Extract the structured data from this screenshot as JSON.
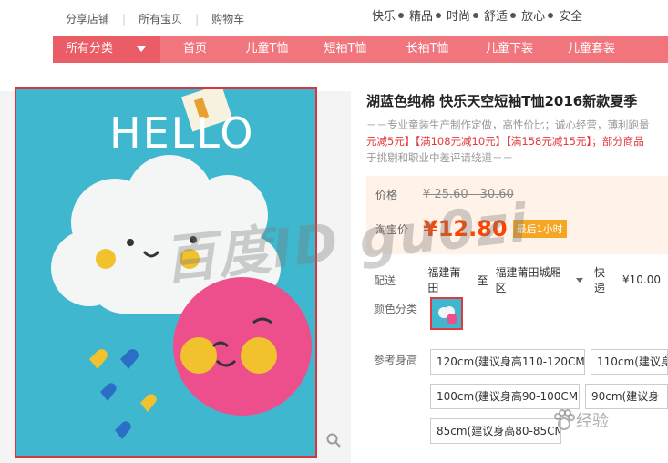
{
  "top_links": [
    "分享店铺",
    "所有宝贝",
    "购物车"
  ],
  "slogan": [
    "快乐",
    "精品",
    "时尚",
    "舒适",
    "放心",
    "安全"
  ],
  "nav": {
    "all_label": "所有分类",
    "items": [
      "首页",
      "儿童T恤",
      "短袖T恤",
      "长袖T恤",
      "儿童下装",
      "儿童套装"
    ]
  },
  "product": {
    "image_text": "HELLO",
    "title": "湖蓝色纯棉 快乐天空短袖T恤2016新款夏季",
    "subtitle_1": "－－专业童装生产制作定做，高性价比；诚心经营，薄利跑量",
    "subtitle_2": "元减5元】【满108元减10元】【满158元减15元】；部分商品",
    "subtitle_3": "于挑剔和职业中差评请绕道－－"
  },
  "price": {
    "label": "价格",
    "old": "¥ 25.60 - 30.60",
    "promo_label": "淘宝价",
    "current": "¥12.80",
    "badge": "最后1小时"
  },
  "shipping": {
    "label": "配送",
    "from": "福建莆田",
    "to_word": "至",
    "to": "福建莆田城厢区",
    "method": "快递",
    "fee": "¥10.00"
  },
  "color": {
    "label": "颜色分类"
  },
  "size": {
    "label": "参考身高",
    "options": [
      "120cm(建议身高110-120CM)",
      "110cm(建议身",
      "100cm(建议身高90-100CM)",
      "90cm(建议身",
      "85cm(建议身高80-85CM)"
    ]
  },
  "watermark": "百度ID gu0zi",
  "jingyan": "经验",
  "colors": {
    "nav": "#f0757d",
    "nav_active": "#ea5d67",
    "price": "#ff4400",
    "tshirt": "#3fb8cf"
  }
}
